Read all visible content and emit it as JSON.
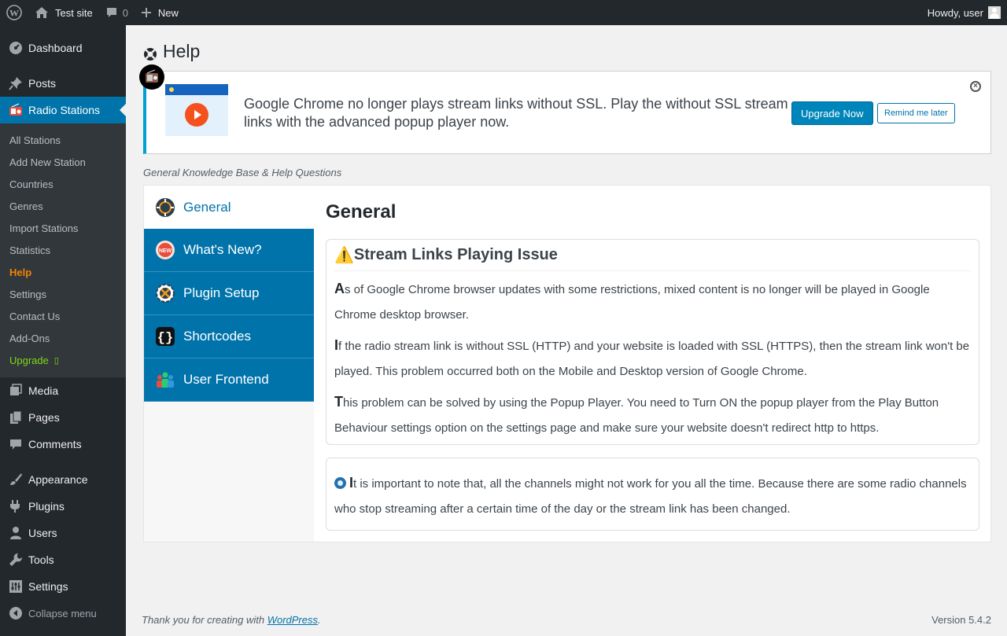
{
  "adminbar": {
    "site_name": "Test site",
    "comments_count": "0",
    "new_label": "New",
    "greeting": "Howdy, user"
  },
  "sidebar": {
    "top_items": [
      {
        "label": "Dashboard",
        "icon": "dashboard-icon"
      },
      {
        "label": "Posts",
        "icon": "pin-icon"
      },
      {
        "label": "Radio Stations",
        "icon": "radio-icon"
      }
    ],
    "submenu": [
      "All Stations",
      "Add New Station",
      "Countries",
      "Genres",
      "Import Stations",
      "Statistics",
      "Help",
      "Settings",
      "Contact Us",
      "Add-Ons",
      "Upgrade"
    ],
    "upgrade_glyph": "▯",
    "bottom_items": [
      {
        "label": "Media",
        "icon": "media-icon"
      },
      {
        "label": "Pages",
        "icon": "pages-icon"
      },
      {
        "label": "Comments",
        "icon": "comment-icon"
      },
      {
        "label": "Appearance",
        "icon": "brush-icon"
      },
      {
        "label": "Plugins",
        "icon": "plugin-icon"
      },
      {
        "label": "Users",
        "icon": "user-icon"
      },
      {
        "label": "Tools",
        "icon": "wrench-icon"
      },
      {
        "label": "Settings",
        "icon": "settings-icon"
      }
    ],
    "collapse_label": "Collapse menu"
  },
  "page": {
    "title": "Help"
  },
  "notice": {
    "text": "Google Chrome no longer plays stream links without SSL. Play the without SSL stream links with the advanced popup player now.",
    "primary_button": "Upgrade Now",
    "secondary_button": "Remind me later"
  },
  "kb_label": "General Knowledge Base & Help Questions",
  "tabs": [
    {
      "label": "General",
      "icon": "general-icon"
    },
    {
      "label": "What's New?",
      "icon": "new-badge-icon"
    },
    {
      "label": "Plugin Setup",
      "icon": "setup-gear-icon"
    },
    {
      "label": "Shortcodes",
      "icon": "code-brackets-icon"
    },
    {
      "label": "User Frontend",
      "icon": "users-group-icon"
    }
  ],
  "content": {
    "heading": "General",
    "issue": {
      "warning_glyph": "⚠️",
      "title": "Stream Links Playing Issue",
      "paragraphs": [
        {
          "cap": "A",
          "text": "s of Google Chrome browser updates with some restrictions, mixed content is no longer will be played in Google Chrome desktop browser."
        },
        {
          "cap": "I",
          "text": "f the radio stream link is without SSL (HTTP) and your website is loaded with SSL (HTTPS), then the stream link won't be played. This problem occurred both on the Mobile and Desktop version of Google Chrome."
        },
        {
          "cap": "T",
          "text": "his problem can be solved by using the Popup Player. You need to Turn ON the popup player from the Play Button Behaviour settings option on the settings page and make sure your website doesn't redirect http to https."
        }
      ]
    },
    "note": {
      "cap": "I",
      "text": "t is important to note that, all the channels might not work for you all the time. Because there are some radio channels who stop streaming after a certain time of the day or the stream link has been changed."
    }
  },
  "footer": {
    "thanks_prefix": "Thank you for creating with ",
    "thanks_link": "WordPress",
    "thanks_suffix": ".",
    "version": "Version 5.4.2"
  },
  "colors": {
    "admin_dark": "#23282d",
    "accent": "#0073aa",
    "help_active": "#f18500",
    "upgrade": "#7fd716",
    "notice_border": "#00a0d2"
  }
}
